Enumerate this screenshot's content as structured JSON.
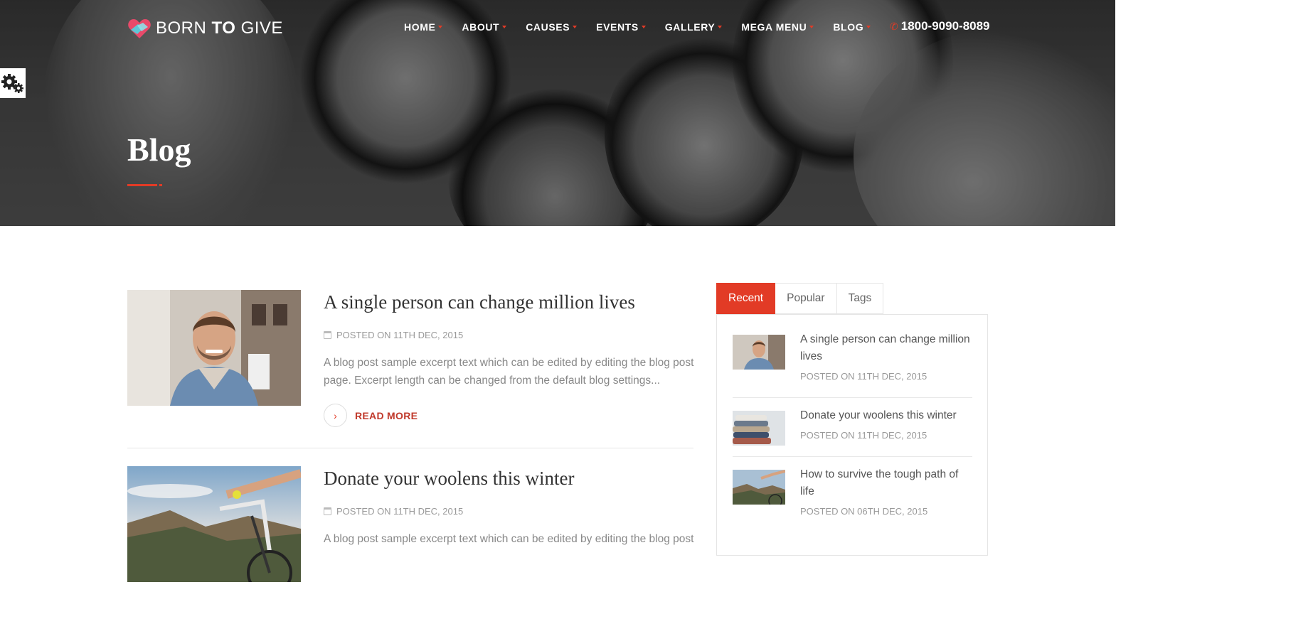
{
  "brand": {
    "name_part1": "BORN ",
    "name_part2": "TO",
    "name_part3": " GIVE",
    "accent": "#e23b26"
  },
  "nav": {
    "items": [
      {
        "label": "HOME"
      },
      {
        "label": "ABOUT"
      },
      {
        "label": "CAUSES"
      },
      {
        "label": "EVENTS"
      },
      {
        "label": "GALLERY"
      },
      {
        "label": "MEGA MENU"
      },
      {
        "label": "BLOG"
      }
    ],
    "phone": "1800-9090-8089",
    "phone_icon": "phone-icon"
  },
  "settings": {
    "icon": "gears-icon"
  },
  "hero": {
    "title": "Blog"
  },
  "posts": [
    {
      "title": "A single person can change million lives",
      "meta": "POSTED ON 11TH DEC, 2015",
      "excerpt": "A blog post sample excerpt text which can be edited by editing the blog post page. Excerpt length can be changed from the default blog settings...",
      "read_more": "READ MORE"
    },
    {
      "title": "Donate your woolens this winter",
      "meta": "POSTED ON 11TH DEC, 2015",
      "excerpt": "A blog post sample excerpt text which can be edited by editing the blog post"
    }
  ],
  "sidebar": {
    "tabs": [
      {
        "label": "Recent"
      },
      {
        "label": "Popular"
      },
      {
        "label": "Tags"
      }
    ],
    "active_tab": "Recent",
    "recent": [
      {
        "title": "A single person can change million lives",
        "meta": "POSTED ON 11TH DEC, 2015"
      },
      {
        "title": "Donate your woolens this winter",
        "meta": "POSTED ON 11TH DEC, 2015"
      },
      {
        "title": "How to survive the tough path of life",
        "meta": "POSTED ON 06TH DEC, 2015"
      }
    ]
  }
}
